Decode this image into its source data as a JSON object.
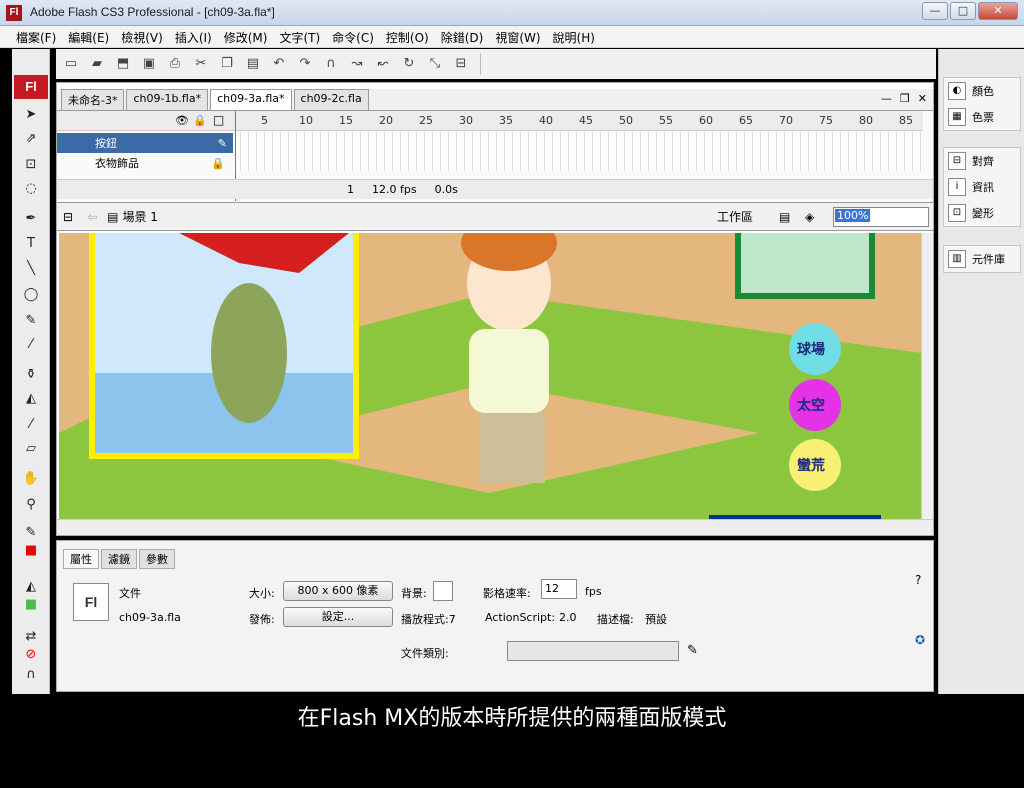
{
  "window": {
    "app_icon": "Fl",
    "title": "Adobe Flash CS3 Professional - [ch09-3a.fla*]",
    "min": "—",
    "max": "□",
    "close": "✕"
  },
  "menubar": [
    "檔案(F)",
    "編輯(E)",
    "檢視(V)",
    "插入(I)",
    "修改(M)",
    "文字(T)",
    "命令(C)",
    "控制(O)",
    "除錯(D)",
    "視窗(W)",
    "說明(H)"
  ],
  "tools_logo": "Fl",
  "doc_tabs": [
    "未命名-3*",
    "ch09-1b.fla*",
    "ch09-3a.fla*",
    "ch09-2c.fla"
  ],
  "timeline": {
    "ruler": [
      "5",
      "10",
      "15",
      "20",
      "25",
      "30",
      "35",
      "40",
      "45",
      "50",
      "55",
      "60",
      "65",
      "70",
      "75",
      "80",
      "85"
    ],
    "layers": [
      "按鈕",
      "衣物飾品"
    ],
    "frame": "1",
    "fps": "12.0 fps",
    "time": "0.0s"
  },
  "editbar": {
    "scene": "場景 1",
    "workspace": "工作區",
    "zoom": "100%"
  },
  "stage": {
    "buttons": [
      "球場",
      "太空",
      "蠻荒"
    ]
  },
  "right_panels": {
    "group1": [
      "顏色",
      "色票"
    ],
    "group2": [
      "對齊",
      "資訊",
      "變形"
    ],
    "group3": [
      "元件庫"
    ]
  },
  "properties": {
    "tabs": [
      "屬性",
      "濾鏡",
      "參數"
    ],
    "doc_label": "文件",
    "filename": "ch09-3a.fla",
    "size_label": "大小:",
    "size_value": "800 x 600 像素",
    "bg_label": "背景:",
    "fps_label": "影格速率:",
    "fps_value": "12",
    "fps_unit": "fps",
    "publish_label": "發佈:",
    "settings_button": "設定...",
    "player_label": "播放程式:7",
    "as_label": "ActionScript:",
    "as_value": "2.0",
    "profile_label": "描述檔:",
    "profile_value": "預設",
    "doc_class_label": "文件類別:"
  },
  "caption": "在Flash MX的版本時所提供的兩種面版模式"
}
